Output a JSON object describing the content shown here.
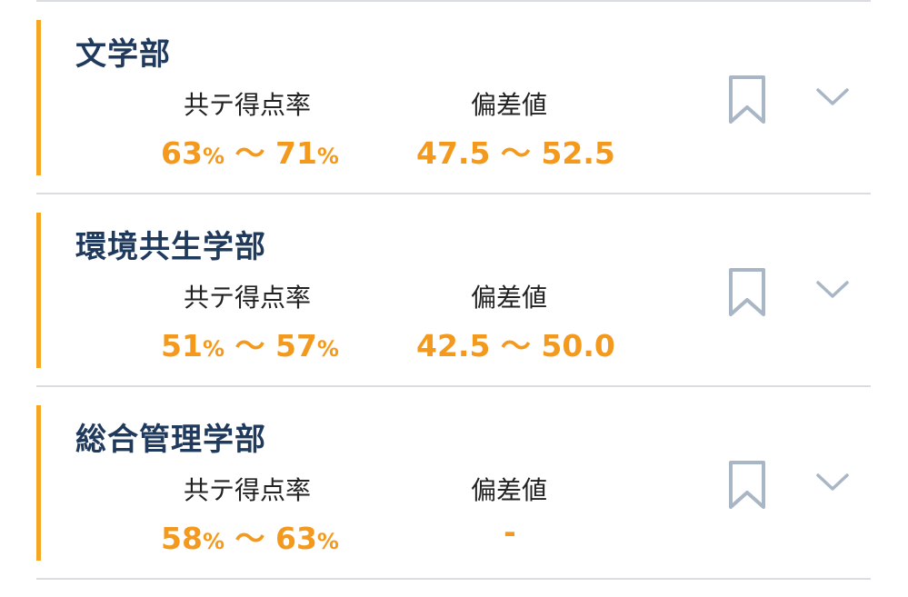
{
  "faculties": [
    {
      "name": "文学部",
      "kyotei_label": "共テ得点率",
      "kyotei_min": "63",
      "kyotei_max": "71",
      "percent": "%",
      "range_sep": "〜",
      "hensachi_label": "偏差値",
      "hensachi_value": "47.5 〜 52.5"
    },
    {
      "name": "環境共生学部",
      "kyotei_label": "共テ得点率",
      "kyotei_min": "51",
      "kyotei_max": "57",
      "percent": "%",
      "range_sep": "〜",
      "hensachi_label": "偏差値",
      "hensachi_value": "42.5 〜 50.0"
    },
    {
      "name": "総合管理学部",
      "kyotei_label": "共テ得点率",
      "kyotei_min": "58",
      "kyotei_max": "63",
      "percent": "%",
      "range_sep": "〜",
      "hensachi_label": "偏差値",
      "hensachi_value": "-"
    }
  ],
  "icons": {
    "bookmark": "bookmark-icon",
    "expand": "chevron-down-icon"
  },
  "colors": {
    "accent": "#f5a623",
    "value": "#f39a1e",
    "title": "#1f3a5c",
    "icon": "#a9b6c6",
    "divider": "#d9dde2"
  }
}
